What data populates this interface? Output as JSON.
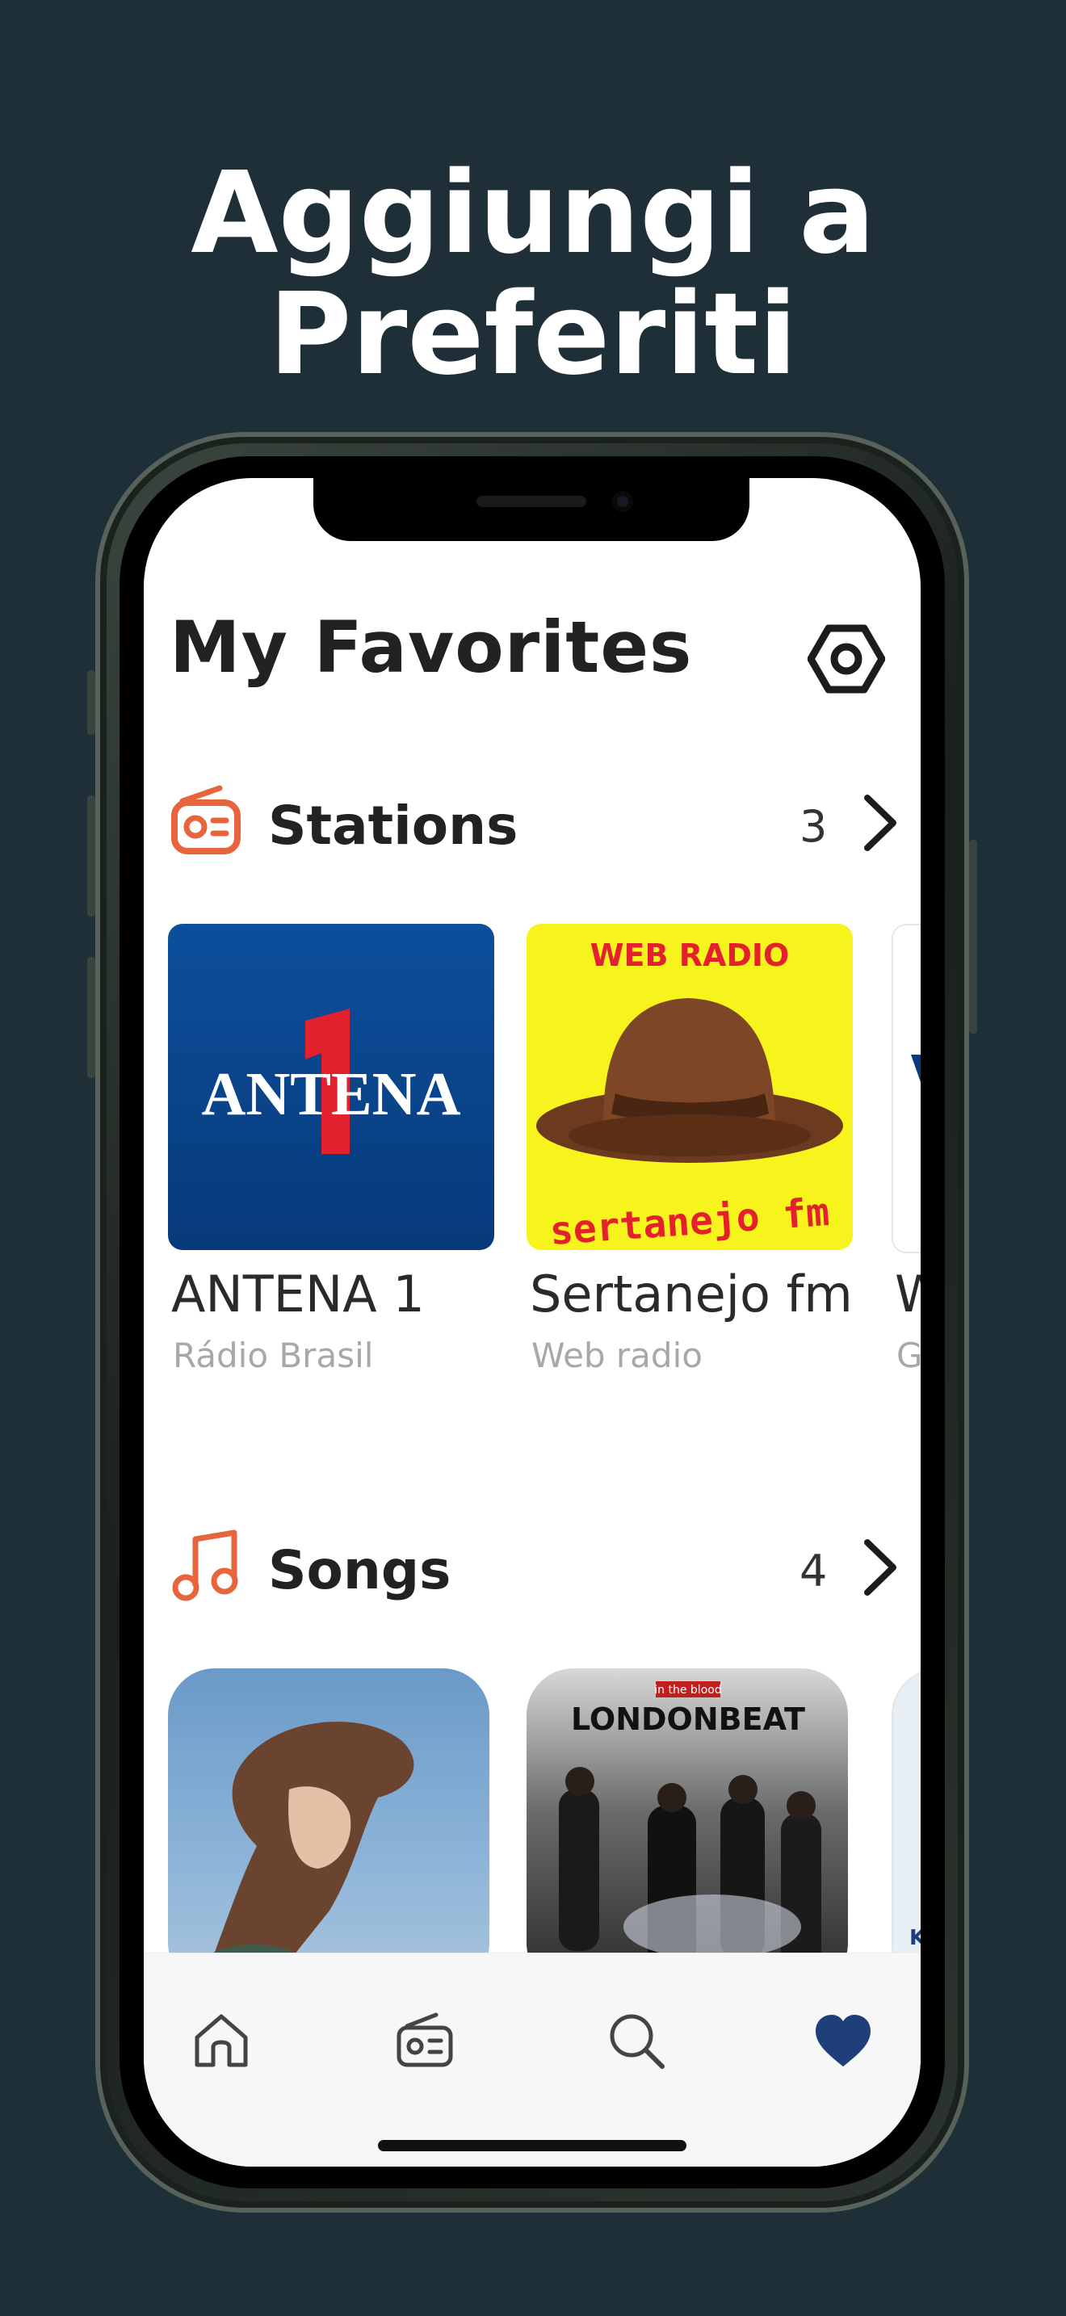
{
  "promo": {
    "line1": "Aggiungi a",
    "line2": "Preferiti"
  },
  "page": {
    "title": "My Favorites"
  },
  "settings": {
    "icon": "settings-hexagon-icon"
  },
  "stations": {
    "title": "Stations",
    "count": "3",
    "icon": "radio-icon",
    "items": [
      {
        "title": "ANTENA 1",
        "subtitle": "Rádio Brasil",
        "logo_text": "ANTENA",
        "logo_digit": "1"
      },
      {
        "title": "Sertanejo fm",
        "subtitle": "Web radio",
        "logo_top": "WEB RADIO",
        "logo_bottom": "sertanejo fm"
      },
      {
        "title": "W",
        "subtitle": "G"
      }
    ]
  },
  "songs": {
    "title": "Songs",
    "count": "4",
    "icon": "music-note-icon",
    "items": [
      {
        "art": "woman-hair-photo"
      },
      {
        "art_label": "in the blood",
        "art_title": "LONDONBEAT"
      },
      {
        "art_partial": "K"
      }
    ]
  },
  "tabbar": {
    "items": [
      "home-icon",
      "radio-icon",
      "search-icon",
      "heart-icon"
    ],
    "active": "heart-icon"
  },
  "colors": {
    "background": "#1f2f38",
    "accent": "#e8643c",
    "active_tab": "#1f3f7a",
    "antena_bg": "#0a4a94",
    "antena_red": "#e3212c",
    "sertanejo_bg": "#f7f31c"
  }
}
